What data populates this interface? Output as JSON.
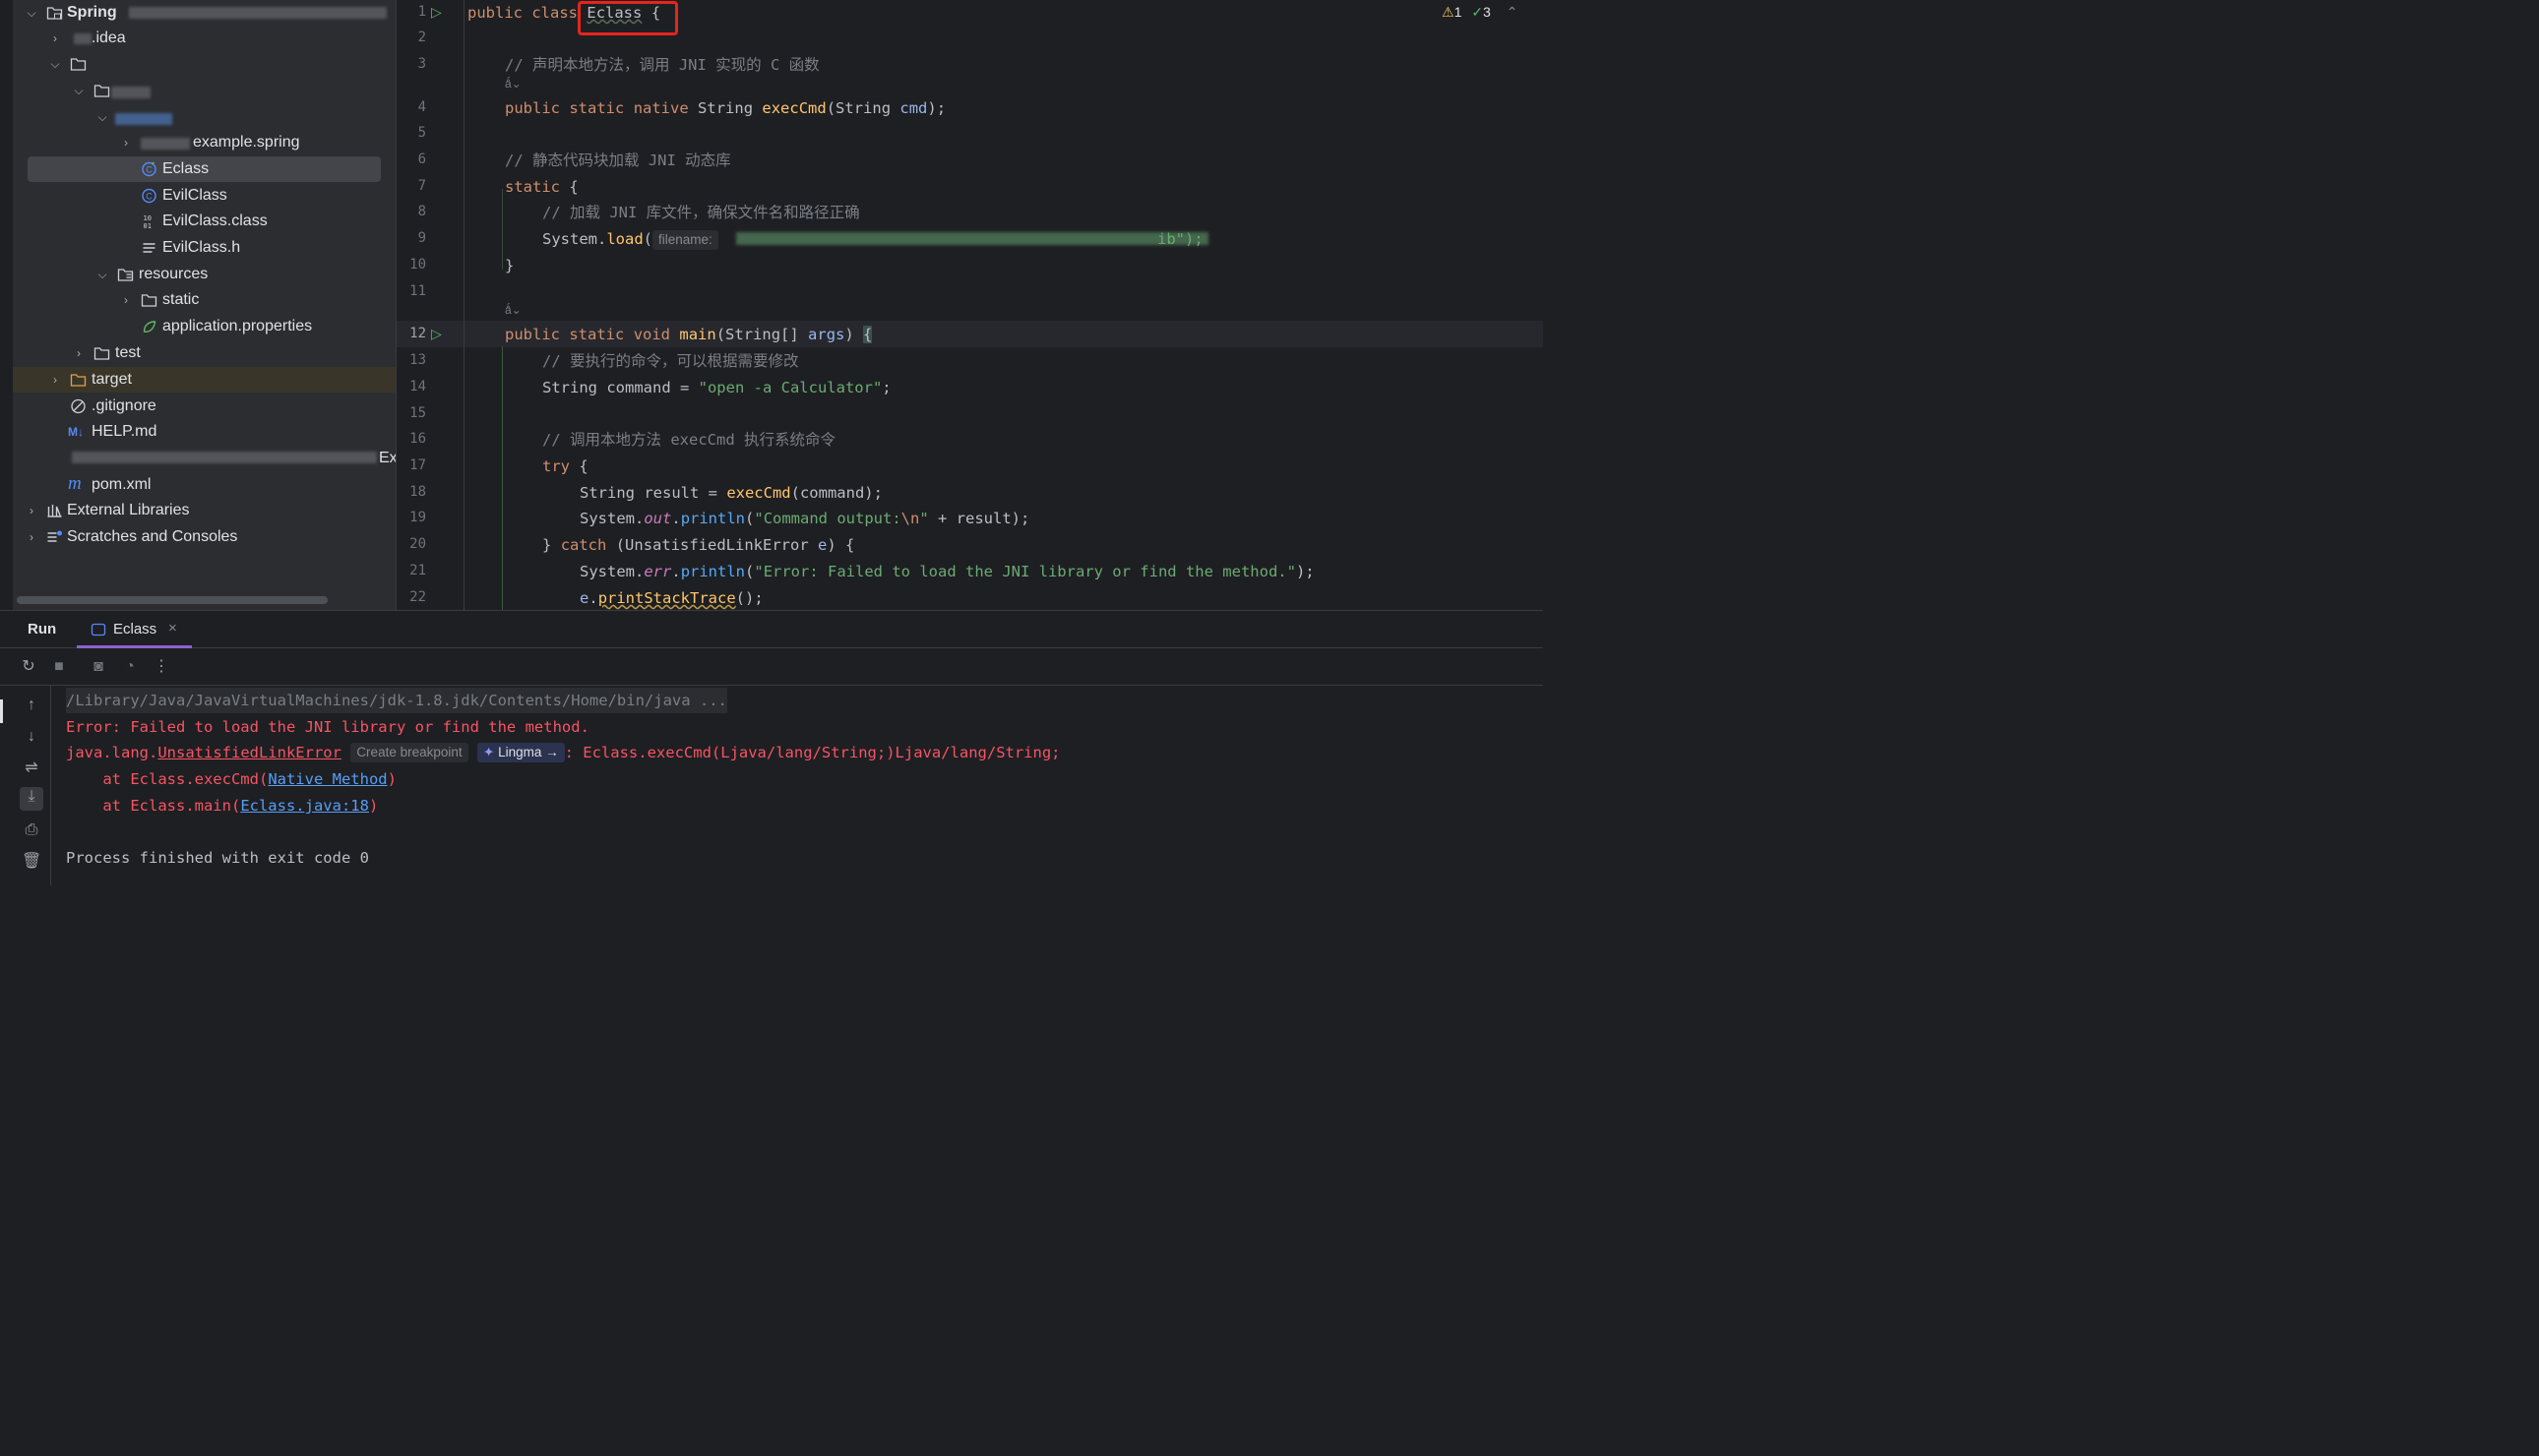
{
  "project_tree": {
    "root_label": "Spring",
    "items": [
      {
        "label": ".idea"
      },
      {
        "label": "example.spring"
      },
      {
        "label": "Eclass"
      },
      {
        "label": "EvilClass"
      },
      {
        "label": "EvilClass.class"
      },
      {
        "label": "EvilClass.h"
      },
      {
        "label": "resources"
      },
      {
        "label": "static"
      },
      {
        "label": "application.properties"
      },
      {
        "label": "test"
      },
      {
        "label": "target"
      },
      {
        "label": ".gitignore"
      },
      {
        "label": "HELP.md"
      },
      {
        "label": "pom.xml"
      },
      {
        "label": "External Libraries"
      },
      {
        "label": "Scratches and Consoles"
      }
    ],
    "partial_text": "Ex"
  },
  "editor": {
    "line_numbers": [
      "1",
      "2",
      "3",
      "4",
      "5",
      "6",
      "7",
      "8",
      "9",
      "10",
      "11",
      "12",
      "13",
      "14",
      "15",
      "16",
      "17",
      "18",
      "19",
      "20",
      "21",
      "22"
    ],
    "status": {
      "warnings": "1",
      "checks": "3"
    },
    "class_name": "Eclass",
    "tokens": {
      "public": "public",
      "class": "class",
      "static": "static",
      "native": "native",
      "void": "void",
      "try": "try",
      "catch": "catch",
      "open_brace": "{",
      "close_brace": "}",
      "cmt3": "// 声明本地方法，调用 JNI 实现的 C 函数",
      "type_string": "String",
      "exec_cmd": "execCmd",
      "paren_open": "(",
      "param_cmd": "cmd",
      "paren_close_semi": ");",
      "usage": "1 usage",
      "cmt6": "// 静态代码块加载 JNI 动态库",
      "cmt8": "// 加载 JNI 库文件，确保文件名和路径正确",
      "system": "System",
      "dot": ".",
      "load": "load",
      "filename_hint": "filename:",
      "load_tail": "ib\");",
      "main": "main",
      "string_arr": "String[]",
      "args": "args",
      "paren_close": ")",
      "cmt13": "// 要执行的命令，可以根据需要修改",
      "cmd_decl": "String command = ",
      "str_calc": "\"open -a Calculator\"",
      "semi": ";",
      "cmt16": "// 调用本地方法 execCmd 执行系统命令",
      "result_decl": "String result = ",
      "command_arg": "(command);",
      "out": "out",
      "err": "err",
      "println": "println",
      "str_output_a": "\"Command output:",
      "str_nl": "\\n",
      "str_quote": "\"",
      "plus_result": " + result);",
      "unsat": "(UnsatisfiedLinkError ",
      "e": "e",
      "str_err": "\"Error: Failed to load the JNI library or find the method.\"",
      "print_trace": "printStackTrace",
      "call_end": "();"
    }
  },
  "run_panel": {
    "title": "Run",
    "tab_label": "Eclass",
    "console": {
      "line1": "/Library/Java/JavaVirtualMachines/jdk-1.8.jdk/Contents/Home/bin/java ...",
      "line2": "Error: Failed to load the JNI library or find the method.",
      "line3_prefix": "java.lang.",
      "line3_link": "UnsatisfiedLinkError",
      "create_breakpoint": "Create breakpoint",
      "lingma": "Lingma →",
      "line3_suffix": ": Eclass.execCmd(Ljava/lang/String;)Ljava/lang/String;",
      "line4_prefix": "    at Eclass.execCmd(",
      "line4_link": "Native Method",
      "line4_suffix": ")",
      "line5_prefix": "    at Eclass.main(",
      "line5_link": "Eclass.java:18",
      "line5_suffix": ")",
      "line7": "Process finished with exit code 0"
    }
  },
  "colors": {
    "accent": "#3574f0",
    "error": "#f75464",
    "highlight_box": "#e5251c",
    "tab_underline": "#8a63d2"
  }
}
